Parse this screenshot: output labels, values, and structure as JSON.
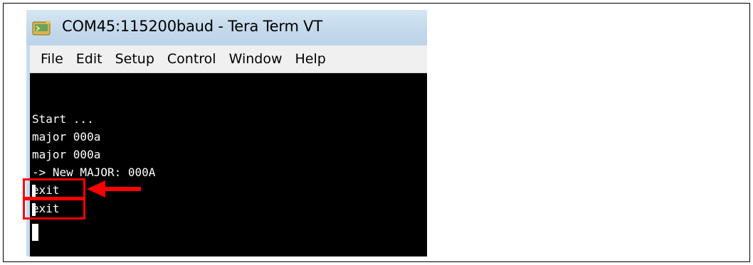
{
  "window": {
    "title": "COM45:115200baud - Tera Term VT",
    "icon": "teraterm-icon"
  },
  "menu": {
    "items": [
      "File",
      "Edit",
      "Setup",
      "Control",
      "Window",
      "Help"
    ]
  },
  "terminal": {
    "lines": [
      "Start ...",
      "major 000a",
      "major 000a",
      "-> New MAJOR: 000A",
      "exit",
      "exit"
    ]
  },
  "annotations": {
    "highlight_color": "#ff0000",
    "arrow_color": "#ff0000",
    "arrow_icon": "left-arrow-icon"
  }
}
